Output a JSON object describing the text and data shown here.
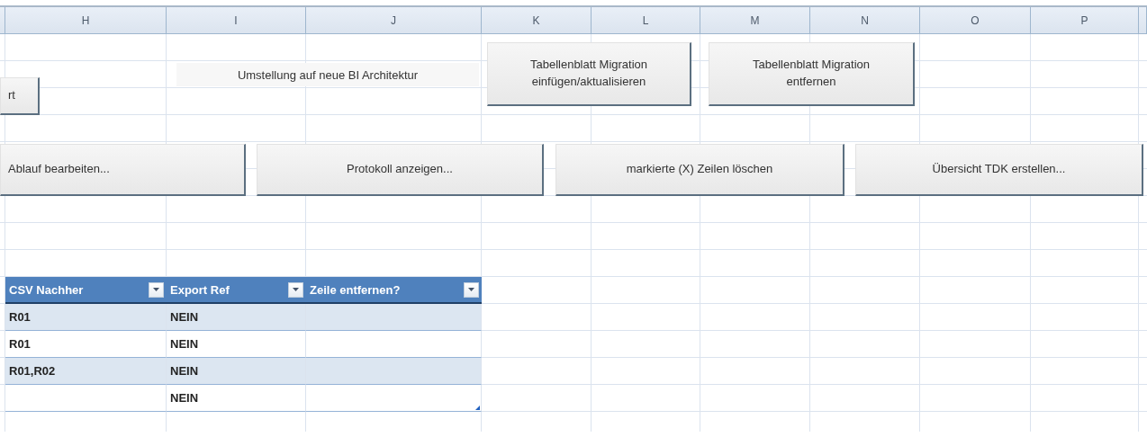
{
  "columns": [
    "H",
    "I",
    "J",
    "K",
    "L",
    "M",
    "N",
    "O",
    "P"
  ],
  "label": "Umstellung auf neue BI Architektur",
  "buttons": [
    {
      "lines": [
        "rt"
      ]
    },
    {
      "lines": [
        "Tabellenblatt Migration",
        "einfügen/aktualisieren"
      ]
    },
    {
      "lines": [
        "Tabellenblatt Migration",
        "entfernen"
      ]
    },
    {
      "lines": [
        "Ablauf bearbeiten..."
      ]
    },
    {
      "lines": [
        "Protokoll anzeigen..."
      ]
    },
    {
      "lines": [
        "markierte (X) Zeilen löschen"
      ]
    },
    {
      "lines": [
        "Übersicht TDK erstellen..."
      ]
    }
  ],
  "table": {
    "columns": [
      "CSV Nachher",
      "Export Ref",
      "Zeile entfernen?"
    ],
    "rows": [
      [
        "R01",
        "NEIN",
        ""
      ],
      [
        "R01",
        "NEIN",
        ""
      ],
      [
        "R01,R02",
        "NEIN",
        ""
      ],
      [
        "",
        "NEIN",
        ""
      ]
    ]
  }
}
